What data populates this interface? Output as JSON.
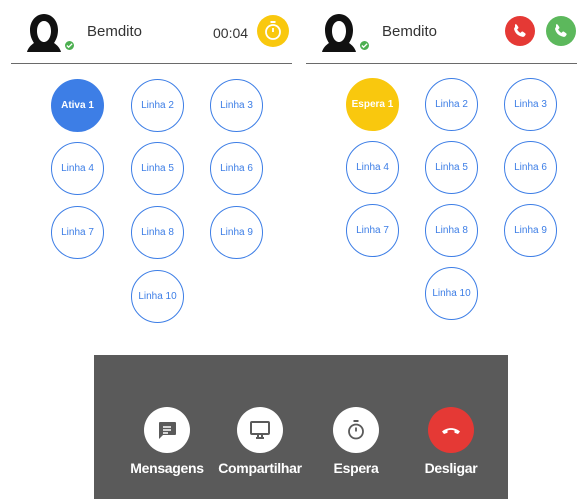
{
  "left_panel": {
    "contact_name": "Bemdito",
    "timer": "00:04",
    "lines": [
      {
        "label": "Ativa 1",
        "state": "active"
      },
      {
        "label": "Linha 2",
        "state": "idle"
      },
      {
        "label": "Linha 3",
        "state": "idle"
      },
      {
        "label": "Linha 4",
        "state": "idle"
      },
      {
        "label": "Linha 5",
        "state": "idle"
      },
      {
        "label": "Linha 6",
        "state": "idle"
      },
      {
        "label": "Linha 7",
        "state": "idle"
      },
      {
        "label": "Linha 8",
        "state": "idle"
      },
      {
        "label": "Linha 9",
        "state": "idle"
      },
      {
        "label": "Linha 10",
        "state": "idle"
      }
    ]
  },
  "right_panel": {
    "contact_name": "Bemdito",
    "lines": [
      {
        "label": "Espera 1",
        "state": "hold"
      },
      {
        "label": "Linha 2",
        "state": "idle"
      },
      {
        "label": "Linha 3",
        "state": "idle"
      },
      {
        "label": "Linha 4",
        "state": "idle"
      },
      {
        "label": "Linha 5",
        "state": "idle"
      },
      {
        "label": "Linha 6",
        "state": "idle"
      },
      {
        "label": "Linha 7",
        "state": "idle"
      },
      {
        "label": "Linha 8",
        "state": "idle"
      },
      {
        "label": "Linha 9",
        "state": "idle"
      },
      {
        "label": "Linha 10",
        "state": "idle"
      }
    ]
  },
  "controls": {
    "messages_label": "Mensagens",
    "share_label": "Compartilhar",
    "hold_label": "Espera",
    "hangup_label": "Desligar"
  },
  "colors": {
    "active": "#3d7ee6",
    "hold": "#f9c80e",
    "reject": "#e53935",
    "accept": "#5cb85c",
    "online": "#4caf50",
    "control_bar": "#5a5a5a"
  },
  "icons": {
    "avatar": "user-avatar-icon",
    "presence": "online-check-icon",
    "hold_indicator": "stopwatch-icon",
    "reject": "phone-reject-icon",
    "accept": "phone-accept-icon",
    "messages": "message-icon",
    "share": "monitor-icon",
    "hold": "stopwatch-icon",
    "hangup": "phone-hangup-icon"
  }
}
